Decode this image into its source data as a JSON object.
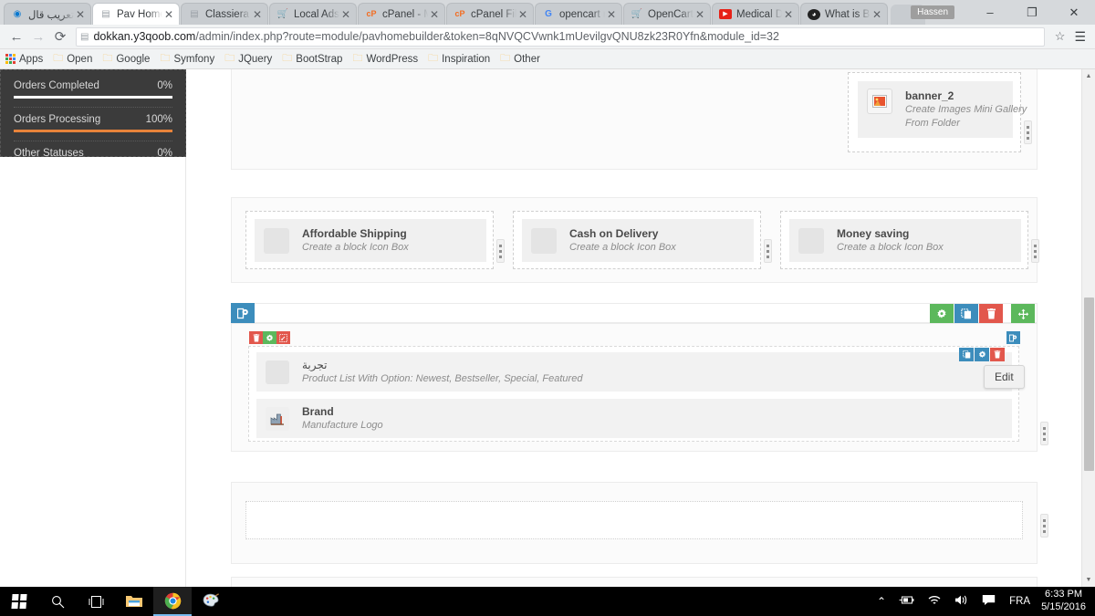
{
  "browser": {
    "tabs": [
      {
        "label": "تعريب قال",
        "favicon": "opera-icon",
        "favicon_glyph": "◉",
        "favicon_color": "#0b79d0",
        "active": false
      },
      {
        "label": "Pav Home",
        "favicon": "page-icon",
        "favicon_glyph": "▤",
        "favicon_color": "#9aa0a6",
        "active": true
      },
      {
        "label": "Classiera C",
        "favicon": "page-icon",
        "favicon_glyph": "▤",
        "favicon_color": "#9aa0a6",
        "active": false
      },
      {
        "label": "Local Ads",
        "favicon": "cart-icon",
        "favicon_glyph": "🛒",
        "favicon_color": "#e2574c",
        "active": false
      },
      {
        "label": "cPanel - M",
        "favicon": "cpanel-icon",
        "favicon_glyph": "cP",
        "favicon_color": "#f36c21",
        "active": false
      },
      {
        "label": "cPanel File",
        "favicon": "cpanel-icon",
        "favicon_glyph": "cP",
        "favicon_color": "#f36c21",
        "active": false
      },
      {
        "label": "opencart r",
        "favicon": "google-icon",
        "favicon_glyph": "G",
        "favicon_color": "#4285f4",
        "active": false
      },
      {
        "label": "OpenCart",
        "favicon": "opencart-icon",
        "favicon_glyph": "🛒",
        "favicon_color": "#1e87c4",
        "active": false
      },
      {
        "label": "Medical D",
        "favicon": "youtube-icon",
        "favicon_glyph": "▶",
        "favicon_color": "#e62117",
        "active": false
      },
      {
        "label": "What is Bl",
        "favicon": "flame-icon",
        "favicon_glyph": "◕",
        "favicon_color": "#222222",
        "active": false
      }
    ],
    "close_glyph": "✕",
    "user_chip": "Hassen",
    "window_controls": {
      "minimize": "–",
      "maximize": "❐",
      "close": "✕"
    },
    "nav": {
      "back": "←",
      "forward": "→",
      "reload": "⟳",
      "page_icon": "▤",
      "star": "☆",
      "menu": "☰"
    },
    "address": {
      "host": "dokkan.y3qoob.com",
      "path": "/admin/index.php?route=module/pavhomebuilder&token=8qNVQCVwnk1mUevilgvQNU8zk23R0Yfn&module_id=32"
    },
    "bookmarks": [
      {
        "label": "Apps",
        "icon": "apps-grid-icon"
      },
      {
        "label": "Open",
        "icon": "folder-icon"
      },
      {
        "label": "Google",
        "icon": "folder-icon"
      },
      {
        "label": "Symfony",
        "icon": "folder-icon"
      },
      {
        "label": "JQuery",
        "icon": "folder-icon"
      },
      {
        "label": "BootStrap",
        "icon": "folder-icon"
      },
      {
        "label": "WordPress",
        "icon": "folder-icon"
      },
      {
        "label": "Inspiration",
        "icon": "folder-icon"
      },
      {
        "label": "Other",
        "icon": "folder-icon"
      }
    ]
  },
  "stats_panel": {
    "rows": [
      {
        "label": "Orders Completed",
        "value": "0%",
        "bar_pct": 100,
        "accent": false
      },
      {
        "label": "Orders Processing",
        "value": "100%",
        "bar_pct": 100,
        "accent": true
      },
      {
        "label": "Other Statuses",
        "value": "0%",
        "bar_pct": 100,
        "accent": false
      }
    ],
    "accent_color": "#e8833a"
  },
  "builder": {
    "banner_block": {
      "title": "banner_2",
      "desc": "Create Images Mini Gallery From Folder",
      "thumb_icon": "image-thumbnail-icon"
    },
    "icon_boxes": [
      {
        "title": "Affordable Shipping",
        "desc": "Create a block Icon Box",
        "thumb_icon": "placeholder-icon"
      },
      {
        "title": "Cash on Delivery",
        "desc": "Create a block Icon Box",
        "thumb_icon": "placeholder-icon"
      },
      {
        "title": "Money saving",
        "desc": "Create a block Icon Box",
        "thumb_icon": "placeholder-icon"
      }
    ],
    "active_row": {
      "layout_icon": "column-layout-icon",
      "toolbar": [
        {
          "name": "settings-button",
          "icon": "gear-icon",
          "glyph": "✿",
          "color": "green"
        },
        {
          "name": "duplicate-button",
          "icon": "copy-icon",
          "glyph": "❐",
          "color": "blue"
        },
        {
          "name": "delete-button",
          "icon": "trash-icon",
          "glyph": "🗑",
          "color": "red"
        },
        {
          "name": "move-button",
          "icon": "move-arrows-icon",
          "glyph": "✛",
          "color": "green"
        }
      ],
      "column_toolbar": [
        {
          "name": "column-delete-button",
          "icon": "trash-icon",
          "glyph": "🗑",
          "color": "red"
        },
        {
          "name": "column-settings-button",
          "icon": "gear-icon",
          "glyph": "✿",
          "color": "green"
        },
        {
          "name": "column-unlink-button",
          "icon": "unlink-icon",
          "glyph": "⌗",
          "color": "red"
        }
      ],
      "column_right_icon": {
        "name": "column-layout-button",
        "icon": "column-layout-icon",
        "glyph": "▯",
        "color": "blue"
      },
      "blocks": [
        {
          "title": "تجربة",
          "desc": "Product List With Option: Newest, Bestseller, Special, Featured",
          "thumb_icon": "placeholder-icon",
          "rtl": true,
          "tools": [
            {
              "name": "block-duplicate-button",
              "icon": "copy-icon",
              "glyph": "❐",
              "color": "blue"
            },
            {
              "name": "block-settings-button",
              "icon": "gear-icon",
              "glyph": "✿",
              "color": "blue"
            },
            {
              "name": "block-delete-button",
              "icon": "trash-icon",
              "glyph": "🗑",
              "color": "red"
            }
          ]
        },
        {
          "title": "Brand",
          "desc": "Manufacture Logo",
          "thumb_icon": "factory-icon",
          "rtl": false,
          "tools": []
        }
      ]
    },
    "edit_tooltip": "Edit",
    "grip_icon": "drag-grip-icon"
  },
  "taskbar": {
    "items": [
      {
        "name": "start-button",
        "icon": "windows-logo-icon"
      },
      {
        "name": "search-button",
        "icon": "search-icon",
        "glyph": "⌕"
      },
      {
        "name": "task-view-button",
        "icon": "task-view-icon",
        "glyph": "❐"
      },
      {
        "name": "file-explorer-button",
        "icon": "folder-icon",
        "glyph": "🗀"
      },
      {
        "name": "chrome-button",
        "icon": "chrome-icon",
        "glyph": "◉",
        "active": true
      },
      {
        "name": "paint-button",
        "icon": "paint-palette-icon",
        "glyph": "🎨"
      }
    ],
    "tray": [
      {
        "name": "show-hidden-icons",
        "icon": "chevron-up-icon",
        "glyph": "⌃"
      },
      {
        "name": "battery-icon",
        "icon": "battery-icon",
        "glyph": "🔋"
      },
      {
        "name": "network-icon",
        "icon": "wifi-icon",
        "glyph": "⌁"
      },
      {
        "name": "volume-icon",
        "icon": "speaker-icon",
        "glyph": "🔊"
      },
      {
        "name": "action-center-icon",
        "icon": "notification-icon",
        "glyph": "🗩"
      }
    ],
    "language": "FRA",
    "time": "6:33 PM",
    "date": "5/15/2016"
  }
}
